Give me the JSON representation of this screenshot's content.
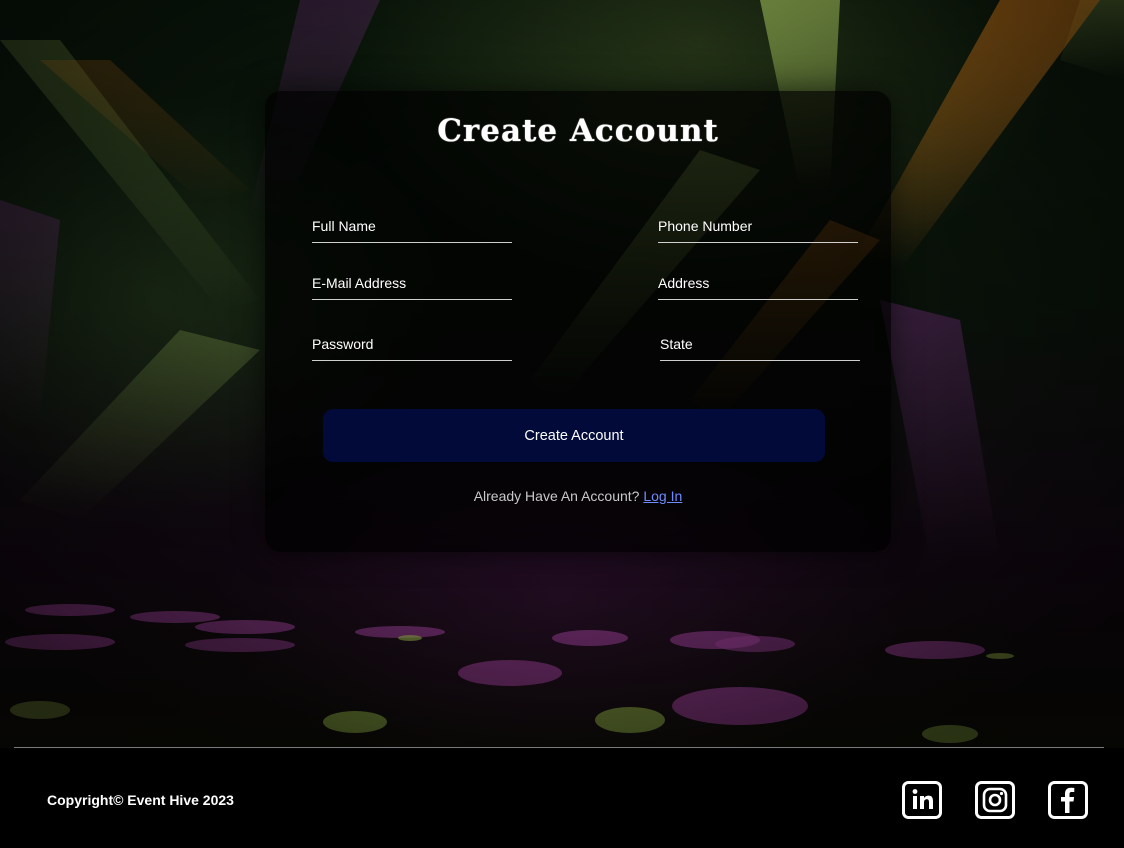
{
  "form": {
    "title": "Create Account",
    "fields": {
      "full_name": {
        "label": "Full Name"
      },
      "phone_number": {
        "label": "Phone Number"
      },
      "email": {
        "label": "E-Mail Address"
      },
      "address": {
        "label": "Address"
      },
      "password": {
        "label": "Password"
      },
      "state": {
        "label": "State"
      }
    },
    "submit_label": "Create Account",
    "login_prompt": "Already Have An Account?",
    "login_link": "Log In"
  },
  "footer": {
    "copyright": "Copyright© Event Hive 2023",
    "social": [
      {
        "name": "linkedin-icon"
      },
      {
        "name": "instagram-icon"
      },
      {
        "name": "facebook-icon"
      }
    ]
  },
  "colors": {
    "button_bg": "#020a3a",
    "link": "#6d8cff",
    "text": "#ffffff"
  }
}
